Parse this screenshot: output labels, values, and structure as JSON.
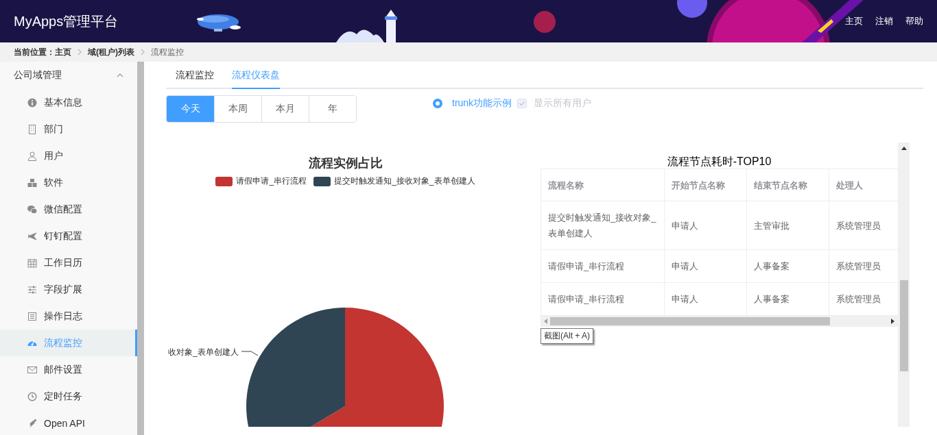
{
  "header": {
    "title": "MyApps管理平台",
    "nav_links": [
      "主页",
      "注销",
      "帮助"
    ]
  },
  "breadcrumb": {
    "label": "当前位置：",
    "items": [
      {
        "text": "主页",
        "current": false
      },
      {
        "text": "域(租户)列表",
        "current": false
      },
      {
        "text": "流程监控",
        "current": true
      }
    ]
  },
  "sidebar": {
    "group": {
      "label": "公司域管理",
      "expanded": true
    },
    "items": [
      {
        "label": "基本信息",
        "selected": false
      },
      {
        "label": "部门",
        "selected": false
      },
      {
        "label": "用户",
        "selected": false
      },
      {
        "label": "软件",
        "selected": false
      },
      {
        "label": "微信配置",
        "selected": false
      },
      {
        "label": "钉钉配置",
        "selected": false
      },
      {
        "label": "工作日历",
        "selected": false
      },
      {
        "label": "字段扩展",
        "selected": false
      },
      {
        "label": "操作日志",
        "selected": false
      },
      {
        "label": "流程监控",
        "selected": true
      },
      {
        "label": "邮件设置",
        "selected": false
      },
      {
        "label": "定时任务",
        "selected": false
      },
      {
        "label": "Open API",
        "selected": false
      }
    ]
  },
  "tabs": [
    {
      "label": "流程监控",
      "selected": false
    },
    {
      "label": "流程仪表盘",
      "selected": true
    }
  ],
  "period_buttons": [
    {
      "label": "今天",
      "selected": true
    },
    {
      "label": "本周",
      "selected": false
    },
    {
      "label": "本月",
      "selected": false
    },
    {
      "label": "年",
      "selected": false
    }
  ],
  "radio": {
    "label": "trunk功能示例",
    "selected": true
  },
  "checkbox": {
    "label": "显示所有用户",
    "checked": true,
    "disabled": true
  },
  "pie_panel": {
    "title": "流程实例占比",
    "legend": [
      {
        "label": "请假申请_串行流程",
        "color": "#c23531"
      },
      {
        "label": "提交时触发通知_接收对象_表单创建人",
        "color": "#2f4554"
      }
    ],
    "slice_label": "收对象_表单创建人"
  },
  "table_panel": {
    "title": "流程节点耗时-TOP10",
    "columns": [
      "流程名称",
      "开始节点名称",
      "结束节点名称",
      "处理人"
    ],
    "rows": [
      [
        "提交时触发通知_接收对象_表单创建人",
        "申请人",
        "主管审批",
        "系统管理员"
      ],
      [
        "请假申请_串行流程",
        "申请人",
        "人事备案",
        "系统管理员"
      ],
      [
        "请假申请_串行流程",
        "申请人",
        "人事备案",
        "系统管理员"
      ]
    ],
    "tooltip": "截图(Alt + A)"
  }
}
